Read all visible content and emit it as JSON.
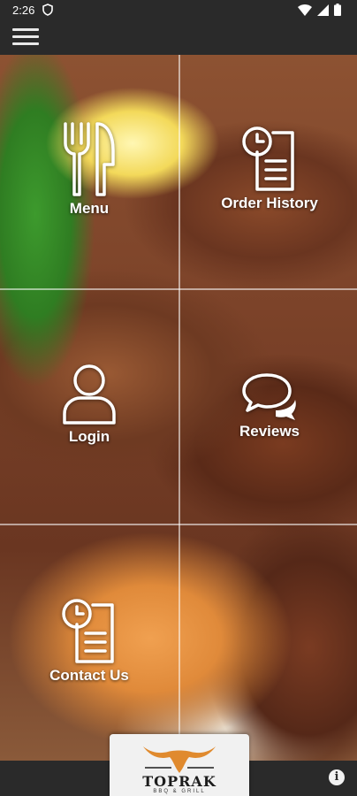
{
  "status_bar": {
    "time": "2:26",
    "icons": [
      "shield-icon",
      "wifi-icon",
      "signal-icon",
      "battery-icon"
    ]
  },
  "app_bar": {
    "menu_icon": "hamburger-icon"
  },
  "tiles": [
    {
      "label": "Menu",
      "icon": "fork-knife-icon"
    },
    {
      "label": "Order History",
      "icon": "clock-document-icon"
    },
    {
      "label": "Login",
      "icon": "user-icon"
    },
    {
      "label": "Reviews",
      "icon": "speech-bubbles-icon"
    },
    {
      "label": "Contact Us",
      "icon": "clock-document-icon"
    }
  ],
  "brand": {
    "name": "TOPRAK",
    "tagline": "BBQ & GRILL",
    "logo_icon": "bull-horns-icon",
    "accent_color": "#e08a2e"
  },
  "bottom_bar": {
    "info_icon": "info-icon",
    "info_glyph": "i"
  }
}
